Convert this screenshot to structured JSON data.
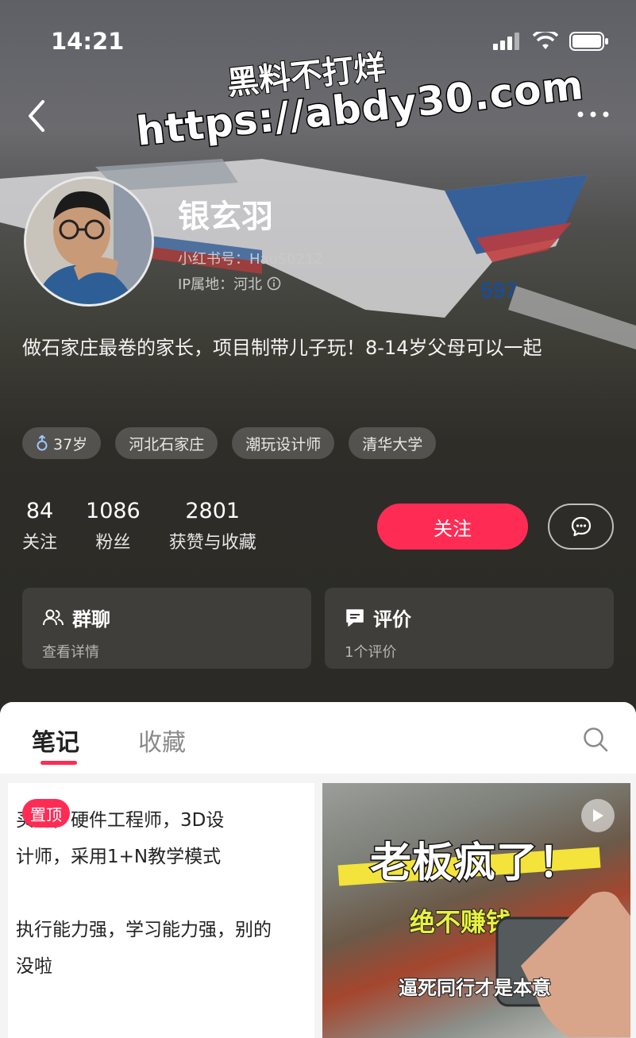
{
  "status_bar": {
    "time": "14:21"
  },
  "watermark": {
    "line1": "黑料不打烊",
    "line2": "https://abdy30.com"
  },
  "profile": {
    "name": "银玄羽",
    "red_id": "小红书号：HaoS0212",
    "ip": "IP属地：河北",
    "bio": "做石家庄最卷的家长，项目制带儿子玩！8-14岁父母可以一起",
    "tags": [
      "37岁",
      "河北石家庄",
      "潮玩设计师",
      "清华大学"
    ],
    "tag_gender_icon": "male-icon",
    "plane_number": "597"
  },
  "stats": [
    {
      "value": "84",
      "label": "关注"
    },
    {
      "value": "1086",
      "label": "粉丝"
    },
    {
      "value": "2801",
      "label": "获赞与收藏"
    }
  ],
  "actions": {
    "follow": "关注",
    "message_icon": "chat-bubble-icon"
  },
  "cards": [
    {
      "title": "群聊",
      "subtitle": "查看详情",
      "icon": "group-icon"
    },
    {
      "title": "评价",
      "subtitle": "1个评价",
      "icon": "comment-icon"
    }
  ],
  "tabs": {
    "notes": "笔记",
    "collections": "收藏"
  },
  "notes": [
    {
      "pinned_label": "置顶",
      "text": "买马，硬件工程师，3D设\n计师，采用1+N教学模式\n\n执行能力强，学习能力强，别的\n没啦"
    },
    {
      "title": "老板疯了！",
      "subtitle": "绝不赚钱",
      "caption": "逼死同行才是本意",
      "type_icon": "play-icon"
    }
  ],
  "colors": {
    "accent": "#fe2c55",
    "background": "#2b2a26"
  }
}
